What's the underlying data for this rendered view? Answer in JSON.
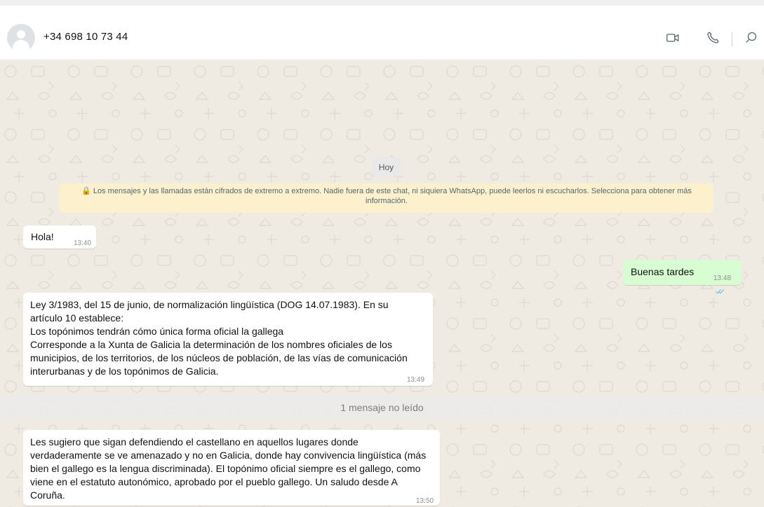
{
  "header": {
    "contact_name": "+34 698 10 73 44",
    "icons": [
      "video-call-icon",
      "voice-call-icon",
      "search-icon"
    ]
  },
  "chat": {
    "date_label": "Hoy",
    "encryption_notice": "🔒 Los mensajes y las llamadas están cifrados de extremo a extremo. Nadie fuera de este chat, ni siquiera WhatsApp, puede leerlos ni escucharlos. Selecciona para obtener más información.",
    "messages": [
      {
        "direction": "in",
        "text": "Hola!",
        "time": "13:40"
      },
      {
        "direction": "out",
        "text": "Buenas tardes",
        "time": "13:48",
        "status": "read"
      },
      {
        "direction": "in",
        "text": "Ley 3/1983, del 15 de junio, de normalización lingüística (DOG 14.07.1983). En su artículo 10 establece:\nLos topónimos tendrán cómo única forma oficial la gallega\nCorresponde a la Xunta de Galicia la determinación de los nombres oficiales de los municipios, de los territorios, de los núcleos de población, de las vías de comunicación interurbanas y de los topónimos de Galicia.",
        "time": "13:49"
      },
      {
        "direction": "in",
        "text": "Les sugiero que sigan defendiendo el castellano en aquellos lugares donde verdaderamente se ve amenazado y no en Galicia, donde hay convivencia lingüística (más bien el gallego es la lengua discriminada). El topónimo oficial siempre es el gallego, como viene en el estatuto autonómico, aprobado por el pueblo gallego. Un saludo desde A Coruña.",
        "time": "13:50"
      }
    ],
    "unread_label": "1 mensaje no leído"
  },
  "colors": {
    "chat_bg": "#efeae2",
    "outgoing_bubble": "#d9fdd3",
    "incoming_bubble": "#ffffff",
    "notice_bg": "#fdf1cd",
    "read_ticks": "#53bdeb"
  }
}
